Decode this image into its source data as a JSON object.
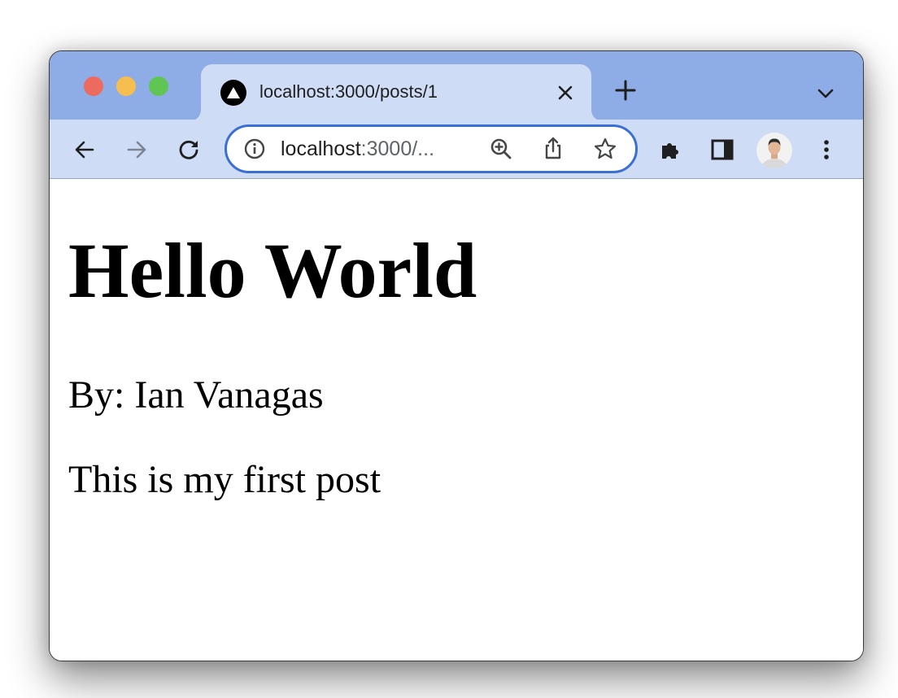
{
  "tab": {
    "title": "localhost:3000/posts/1",
    "favicon": "triangle-logo-icon"
  },
  "omnibox": {
    "url_host": "localhost",
    "url_rest": ":3000/..."
  },
  "colors": {
    "tabstrip": "#8eace6",
    "toolbar": "#cfdcf6",
    "omnibox_border": "#3b6fd4"
  },
  "icons": {
    "back": "back-arrow-icon",
    "forward": "forward-arrow-icon",
    "reload": "reload-icon",
    "info": "info-icon",
    "zoom": "zoom-in-icon",
    "share": "share-icon",
    "bookmark": "star-icon",
    "extensions": "puzzle-icon",
    "side_panel": "side-panel-icon",
    "menu": "kebab-menu-icon",
    "new_tab": "plus-icon",
    "tab_search": "chevron-down-icon",
    "close_tab": "close-icon"
  },
  "page": {
    "heading": "Hello World",
    "author": "By: Ian Vanagas",
    "body": "This is my first post"
  }
}
